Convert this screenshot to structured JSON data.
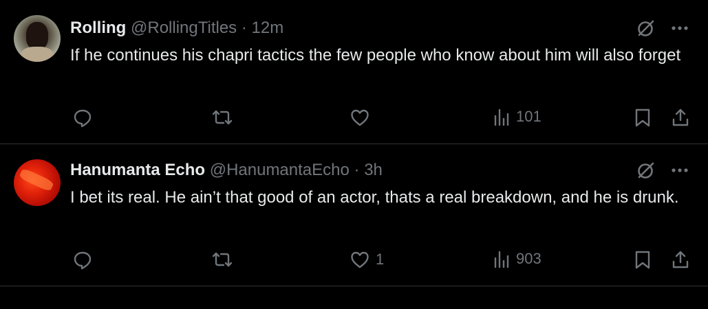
{
  "tweets": [
    {
      "name": "Rolling",
      "handle": "@RollingTitles",
      "dot": "·",
      "time": "12m",
      "text": "If he continues his chapri tactics the few people who know about him will also forget",
      "likes": "",
      "views": "101"
    },
    {
      "name": "Hanumanta Echo",
      "handle": "@HanumantaEcho",
      "dot": "·",
      "time": "3h",
      "text": "I bet its real. He ain’t that good of an actor, thats a real breakdown, and he is drunk.",
      "likes": "1",
      "views": "903"
    }
  ],
  "icons": {
    "grok": "grok-icon",
    "more": "more-icon",
    "reply": "reply-icon",
    "retweet": "retweet-icon",
    "like": "heart-icon",
    "views": "views-icon",
    "bookmark": "bookmark-icon",
    "share": "share-icon"
  },
  "colors": {
    "background": "#000000",
    "text": "#e7e9ea",
    "muted": "#71767b",
    "divider": "#2f3336"
  }
}
